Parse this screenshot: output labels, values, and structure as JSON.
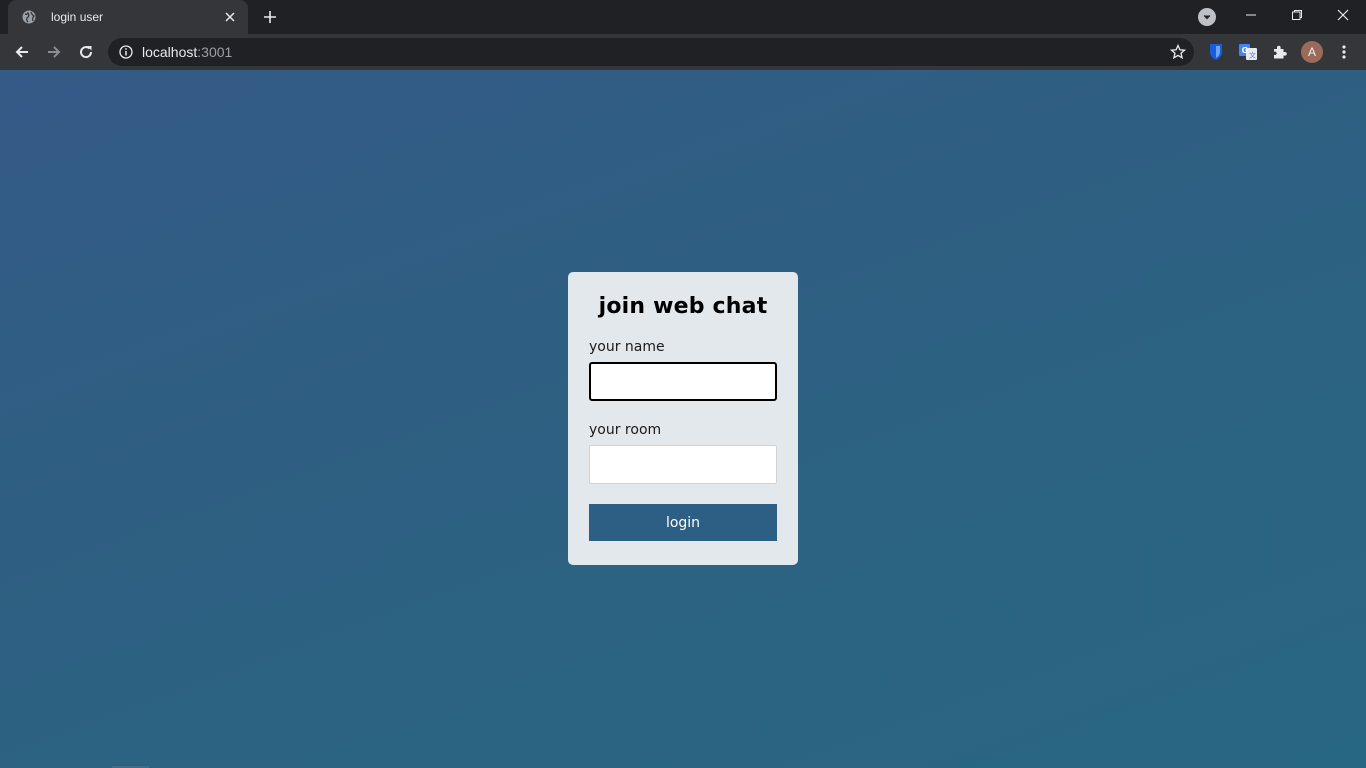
{
  "browser": {
    "tab_title": "login user",
    "url_host": "localhost",
    "url_port": ":3001",
    "avatar_letter": "A"
  },
  "form": {
    "heading": "join web chat",
    "name_label": "your name",
    "name_value": "",
    "room_label": "your room",
    "room_value": "",
    "submit_label": "login"
  },
  "colors": {
    "background_gradient_start": "#345a87",
    "background_gradient_end": "#286783",
    "card": "#e3e8ed",
    "button": "#2c5f83"
  }
}
